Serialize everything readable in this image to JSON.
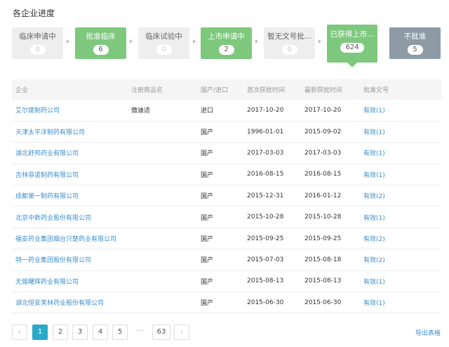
{
  "title": "各企业进度",
  "stages": [
    {
      "label": "临床申请中",
      "count": "0"
    },
    {
      "label": "批准临床",
      "count": "6"
    },
    {
      "label": "临床试验中",
      "count": "0"
    },
    {
      "label": "上市申请中",
      "count": "2"
    },
    {
      "label": "暂无文号批...",
      "count": "0"
    },
    {
      "label": "已获得上市...",
      "count": "624"
    },
    {
      "label": "不批准",
      "count": "5"
    }
  ],
  "table": {
    "headers": [
      "企业",
      "注册商品名",
      "国产/进口",
      "首次获批时间",
      "最新获批时间",
      "批准文号"
    ],
    "rows": [
      [
        "艾尔建制药公司",
        "傲迪适",
        "进口",
        "2017-10-20",
        "2017-10-20",
        "有效(1)"
      ],
      [
        "天津太平洋制药有限公司",
        "",
        "国产",
        "1996-01-01",
        "2015-09-02",
        "有效(1)"
      ],
      [
        "湖北舒邦药业有限公司",
        "",
        "国产",
        "2017-03-03",
        "2017-03-03",
        "有效(1)"
      ],
      [
        "吉林菲诺制药有限公司",
        "",
        "国产",
        "2016-08-15",
        "2016-08-15",
        "有效(1)"
      ],
      [
        "成都第一制药有限公司",
        "",
        "国产",
        "2015-12-31",
        "2016-01-12",
        "有效(2)"
      ],
      [
        "北京中新药业股份有限公司",
        "",
        "国产",
        "2015-10-28",
        "2015-10-28",
        "有效(1)"
      ],
      [
        "福安药业集团烟台只楚药业有限公司",
        "",
        "国产",
        "2015-09-25",
        "2015-09-25",
        "有效(2)"
      ],
      [
        "特一药业集团股份有限公司",
        "",
        "国产",
        "2015-07-03",
        "2015-08-18",
        "有效(2)"
      ],
      [
        "无锡曙辉药业有限公司",
        "",
        "国产",
        "2015-08-13",
        "2015-08-13",
        "有效(1)"
      ],
      [
        "湖北恒安芙林药业股份有限公司",
        "",
        "国产",
        "2015-06-30",
        "2015-06-30",
        "有效(1)"
      ]
    ]
  },
  "pagination": {
    "prev": "‹",
    "pages": [
      "1",
      "2",
      "3",
      "4",
      "5"
    ],
    "ellipsis": "···",
    "last": "63",
    "next": "›"
  },
  "export_label": "导出表格",
  "colors": {
    "stage_inactive": "#eeeeee",
    "stage_active": "#7ec87e",
    "stage_rejected": "#8c9ba6",
    "link": "#3b8ed0",
    "page_current": "#2aa8c8"
  }
}
